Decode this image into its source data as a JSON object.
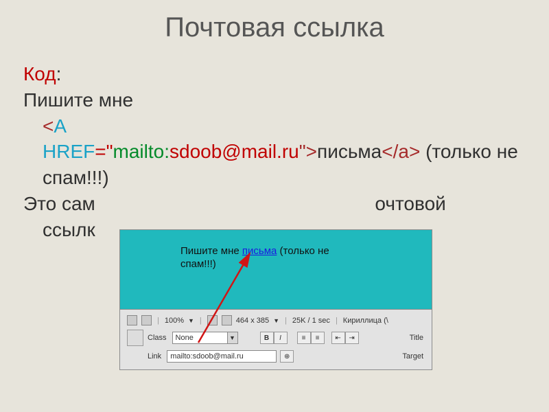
{
  "title": "Почтовая ссылка",
  "codeLabel": "Код",
  "line1": "Пишите мне",
  "tagOpen": "<",
  "tagA": "A",
  "attrHref": "HREF",
  "eq": "=\"",
  "mailto": "mailto:",
  "email": "sdoob@mail.ru",
  "closeQuoteGt": "\">",
  "linkWord": "письма",
  "closeA": "</a>",
  "rest": " (только не спам!!!)",
  "line3a": "Это сам",
  "line3b": "очтовой",
  "line4": "ссылк",
  "teal": {
    "pre": "Пишите мне ",
    "link": "письма",
    "post1": " (только не",
    "post2": "спам!!!)"
  },
  "panel": {
    "pct": "100%",
    "dims": "464 x 385",
    "size": "25K / 1 sec",
    "enc": "Кириллица (\\",
    "classLabel": "Class",
    "classValue": "None",
    "titleLabel": "Title",
    "linkLabel": "Link",
    "linkValue": "mailto:sdoob@mail.ru",
    "targetLabel": "Target"
  }
}
